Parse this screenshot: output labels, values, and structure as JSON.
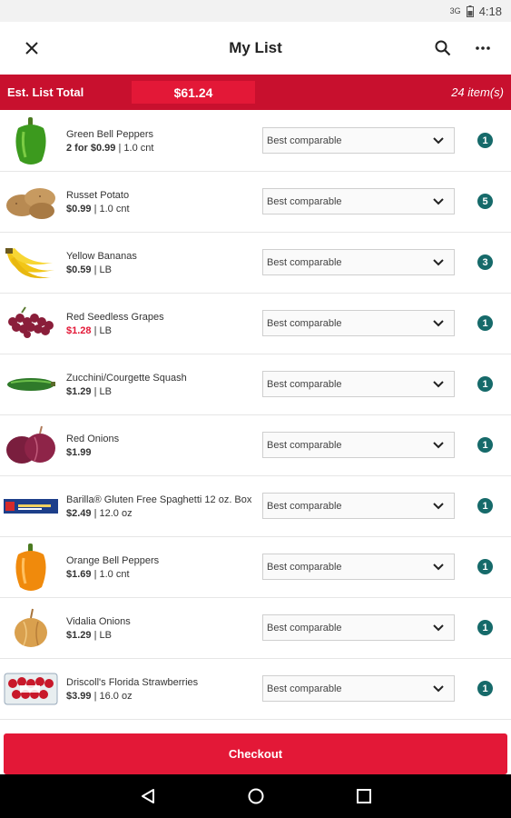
{
  "status": {
    "signal": "3G",
    "time": "4:18"
  },
  "header": {
    "title": "My List",
    "close_icon": "close-icon",
    "search_icon": "search-icon",
    "more_icon": "more-icon"
  },
  "summary": {
    "label": "Est. List Total",
    "total": "$61.24",
    "count": "24 item(s)"
  },
  "items": [
    {
      "name": "Green Bell Peppers",
      "price": "2 for $0.99",
      "unit": "| 1.0 cnt",
      "sale": false,
      "option": "Best comparable",
      "qty": "1",
      "image": "green-pepper"
    },
    {
      "name": "Russet Potato",
      "price": "$0.99",
      "unit": "| 1.0 cnt",
      "sale": false,
      "option": "Best comparable",
      "qty": "5",
      "image": "potato"
    },
    {
      "name": "Yellow Bananas",
      "price": "$0.59",
      "unit": "| LB",
      "sale": false,
      "option": "Best comparable",
      "qty": "3",
      "image": "banana"
    },
    {
      "name": "Red Seedless Grapes",
      "price": "$1.28",
      "unit": "| LB",
      "sale": true,
      "option": "Best comparable",
      "qty": "1",
      "image": "grapes"
    },
    {
      "name": "Zucchini/Courgette Squash",
      "price": "$1.29",
      "unit": "| LB",
      "sale": false,
      "option": "Best comparable",
      "qty": "1",
      "image": "zucchini"
    },
    {
      "name": "Red Onions",
      "price": "$1.99",
      "unit": "",
      "sale": false,
      "option": "Best comparable",
      "qty": "1",
      "image": "red-onion"
    },
    {
      "name": "Barilla® Gluten Free Spaghetti 12 oz. Box",
      "price": "$2.49",
      "unit": "| 12.0 oz",
      "sale": false,
      "option": "Best comparable",
      "qty": "1",
      "image": "pasta-box"
    },
    {
      "name": "Orange Bell Peppers",
      "price": "$1.69",
      "unit": "| 1.0 cnt",
      "sale": false,
      "option": "Best comparable",
      "qty": "1",
      "image": "orange-pepper"
    },
    {
      "name": "Vidalia Onions",
      "price": "$1.29",
      "unit": "| LB",
      "sale": false,
      "option": "Best comparable",
      "qty": "1",
      "image": "onion"
    },
    {
      "name": "Driscoll's Florida Strawberries",
      "price": "$3.99",
      "unit": "| 16.0 oz",
      "sale": false,
      "option": "Best comparable",
      "qty": "1",
      "image": "strawberries"
    }
  ],
  "checkout": {
    "label": "Checkout"
  },
  "nav": {
    "back_icon": "back-icon",
    "home_icon": "home-icon",
    "recents_icon": "recents-icon"
  },
  "colors": {
    "brand": "#c8102e",
    "accent": "#e31837",
    "qty_badge": "#166a6a"
  }
}
